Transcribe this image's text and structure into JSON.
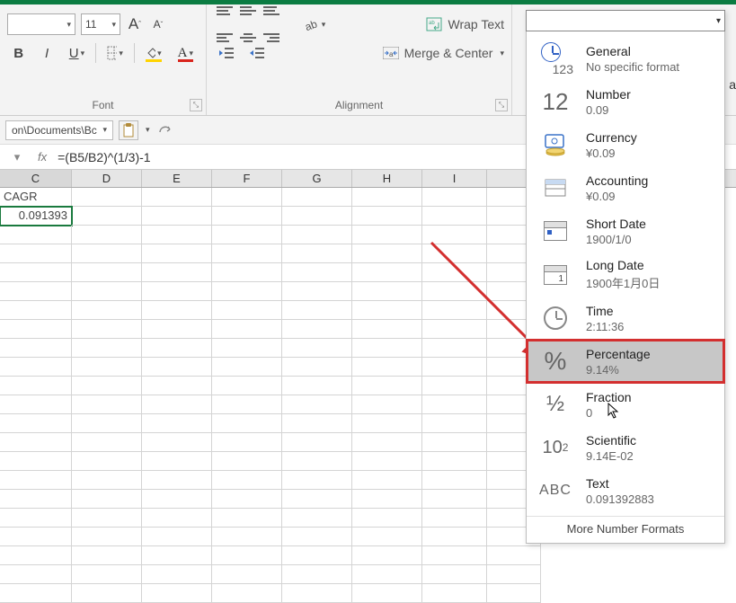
{
  "ribbon": {
    "font": {
      "size": "11",
      "grow_label": "A",
      "shrink_label": "A",
      "bold": "B",
      "italic": "I",
      "underline": "U",
      "font_label": "Font"
    },
    "alignment": {
      "wrap_text": "Wrap Text",
      "merge_center": "Merge & Center",
      "label": "Alignment"
    }
  },
  "number_format": {
    "selected": "",
    "items": [
      {
        "title": "General",
        "sub": "No specific format"
      },
      {
        "title": "Number",
        "sub": "0.09"
      },
      {
        "title": "Currency",
        "sub": "¥0.09"
      },
      {
        "title": "Accounting",
        "sub": "¥0.09"
      },
      {
        "title": "Short Date",
        "sub": "1900/1/0"
      },
      {
        "title": "Long Date",
        "sub": "1900年1月0日"
      },
      {
        "title": "Time",
        "sub": "2:11:36"
      },
      {
        "title": "Percentage",
        "sub": "9.14%"
      },
      {
        "title": "Fraction",
        "sub": "0"
      },
      {
        "title": "Scientific",
        "sub": "9.14E-02"
      },
      {
        "title": "Text",
        "sub": "0.091392883"
      }
    ],
    "more": "More Number Formats"
  },
  "path_bar": {
    "path": "on\\Documents\\Bc"
  },
  "formula_bar": {
    "fx": "fx",
    "formula": "=(B5/B2)^(1/3)-1"
  },
  "columns": [
    "C",
    "D",
    "E",
    "F",
    "G",
    "H",
    "I"
  ],
  "cells": {
    "C1": "CAGR",
    "C2": "0.091393"
  },
  "extra_label": "a"
}
